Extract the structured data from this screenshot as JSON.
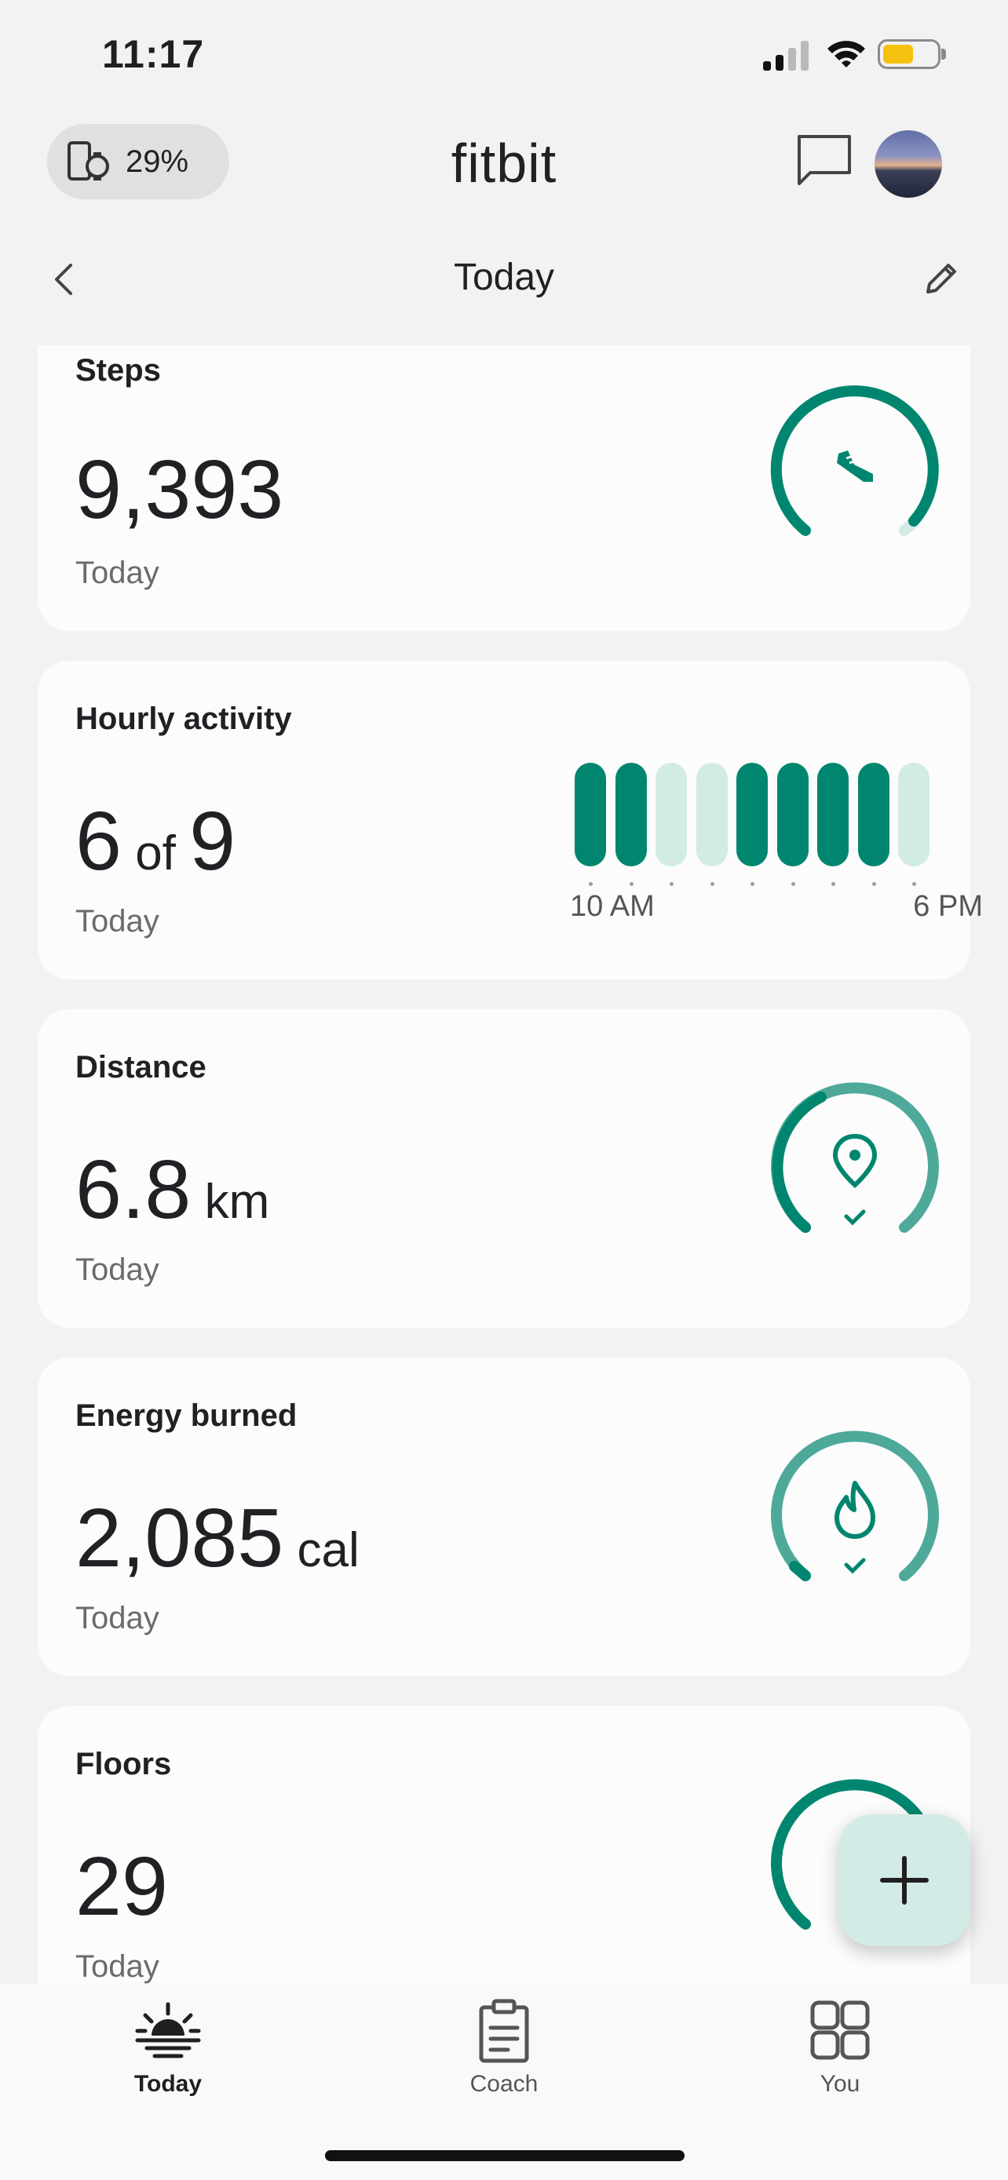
{
  "status_bar": {
    "time": "11:17"
  },
  "header": {
    "device_battery": "29%",
    "brand": "fitbit",
    "page_title": "Today"
  },
  "cards": {
    "steps": {
      "title": "Steps",
      "value": "9,393",
      "sub": "Today"
    },
    "hourly": {
      "title": "Hourly activity",
      "value_a": "6",
      "value_of": "of",
      "value_b": "9",
      "sub": "Today",
      "start_label": "10 AM",
      "end_label": "6 PM",
      "hours_active": [
        true,
        true,
        false,
        false,
        true,
        true,
        true,
        true,
        false
      ]
    },
    "distance": {
      "title": "Distance",
      "value": "6.8",
      "unit": "km",
      "sub": "Today"
    },
    "energy": {
      "title": "Energy burned",
      "value": "2,085",
      "unit": "cal",
      "sub": "Today"
    },
    "floors": {
      "title": "Floors",
      "value": "29",
      "sub": "Today"
    }
  },
  "nav": {
    "today": "Today",
    "coach": "Coach",
    "you": "You"
  },
  "colors": {
    "accent": "#00866f",
    "accent_light": "#d2ebe5",
    "ring_done": "#4ea99b"
  }
}
